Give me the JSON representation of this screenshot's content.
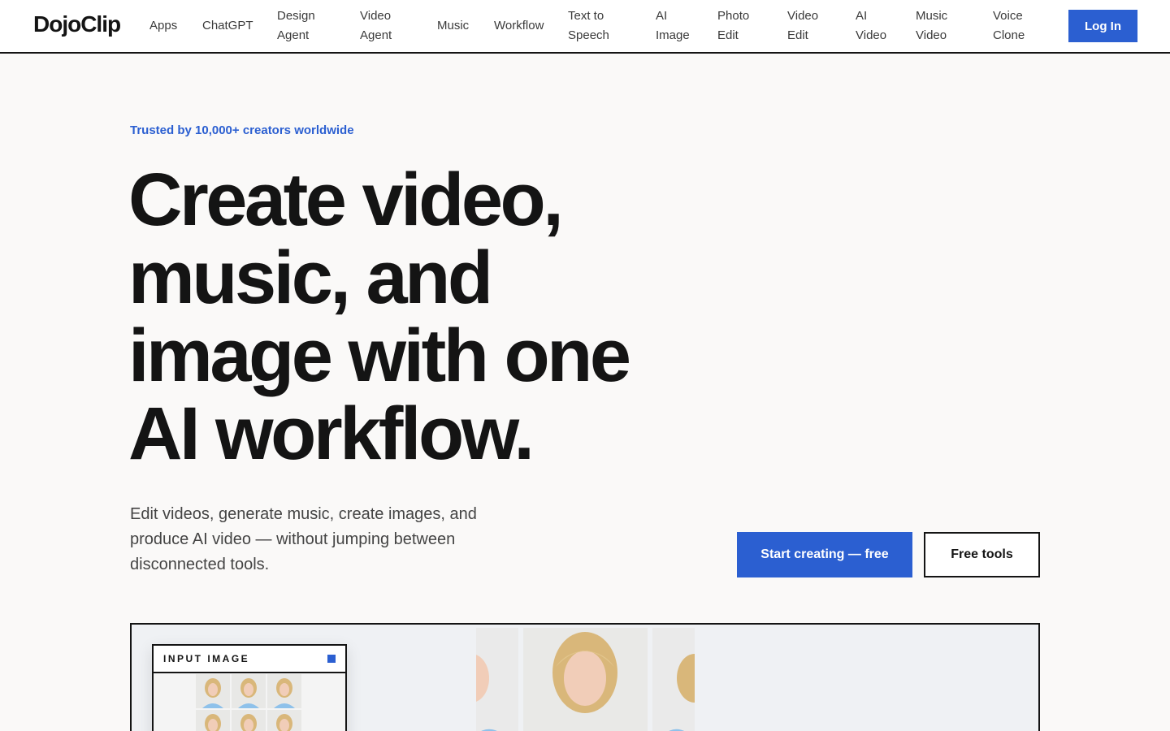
{
  "brand": {
    "logo": "DojoClip",
    "accent": "#2b5fd1"
  },
  "nav": {
    "items": [
      {
        "label": "Apps"
      },
      {
        "label": "ChatGPT"
      },
      {
        "line1": "Design",
        "line2": "Agent"
      },
      {
        "line1": "Video",
        "line2": "Agent"
      },
      {
        "label": "Music"
      },
      {
        "label": "Workflow"
      },
      {
        "line1": "Text to",
        "line2": "Speech"
      },
      {
        "line1": "AI",
        "line2": "Image"
      },
      {
        "line1": "Photo",
        "line2": "Edit"
      },
      {
        "line1": "Video",
        "line2": "Edit"
      },
      {
        "line1": "AI",
        "line2": "Video"
      },
      {
        "line1": "Music",
        "line2": "Video"
      },
      {
        "line1": "Voice",
        "line2": "Clone"
      }
    ],
    "login_label": "Log In"
  },
  "hero": {
    "trusted": "Trusted by 10,000+ creators worldwide",
    "headline": [
      "Create video,",
      "music, and",
      "image with one",
      "AI workflow."
    ],
    "subtext": "Edit videos, generate music, create images, and produce AI video — without jumping between disconnected tools.",
    "cta_primary": "Start creating — free",
    "cta_secondary": "Free tools"
  },
  "demo": {
    "input_label": "INPUT IMAGE"
  }
}
